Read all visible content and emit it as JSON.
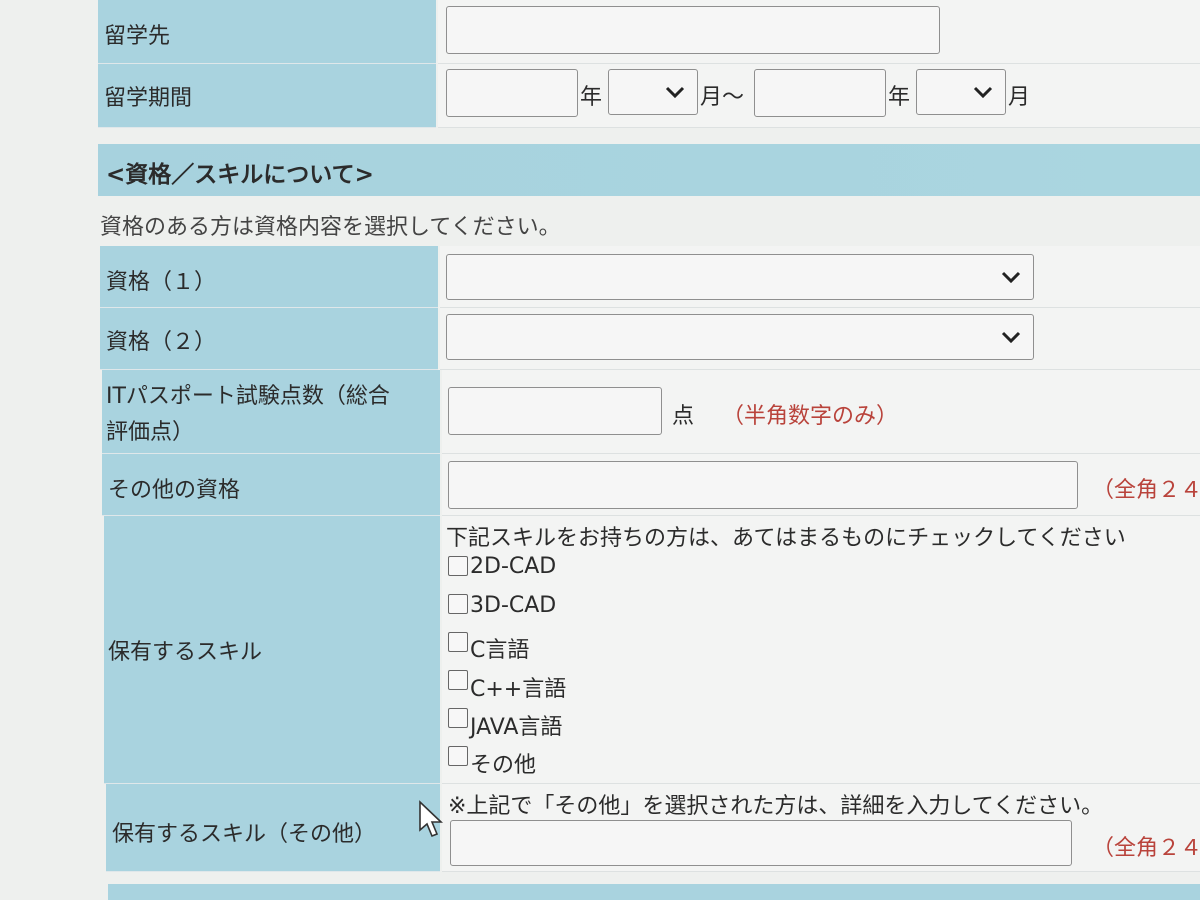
{
  "study_abroad": {
    "destination_label": "留学先",
    "destination_value": "",
    "period_label": "留学期間",
    "start_year_value": "",
    "year_unit": "年",
    "start_month_value": "",
    "month_range_sep": "月～",
    "end_year_value": "",
    "end_month_value": "",
    "month_unit": "月"
  },
  "section": {
    "title": "<資格／スキルについて>",
    "instruction": "資格のある方は資格内容を選択してください。"
  },
  "qualifications": [
    {
      "label": "資格（１）",
      "selected": ""
    },
    {
      "label": "資格（２）",
      "selected": ""
    }
  ],
  "it_passport": {
    "label_line1": "ITパスポート試験点数（総合",
    "label_line2": "評価点）",
    "value": "",
    "unit": "点",
    "note": "（半角数字のみ）"
  },
  "other_qualification": {
    "label": "その他の資格",
    "value": "",
    "note": "（全角２４"
  },
  "skills": {
    "label": "保有するスキル",
    "instruction": "下記スキルをお持ちの方は、あてはまるものにチェックしてください",
    "options": [
      {
        "label": "2D-CAD",
        "checked": false
      },
      {
        "label": "3D-CAD",
        "checked": false
      },
      {
        "label": "C言語",
        "checked": false
      },
      {
        "label": "C++言語",
        "checked": false
      },
      {
        "label": "JAVA言語",
        "checked": false
      },
      {
        "label": "その他",
        "checked": false
      }
    ]
  },
  "skills_other": {
    "label": "保有するスキル（その他）",
    "instruction": "※上記で「その他」を選択された方は、詳細を入力してください。",
    "value": "",
    "note": "（全角２４"
  },
  "colors": {
    "label_bg": "#a9d3df",
    "field_bg": "#f3f4f3",
    "note_red": "#b9433b"
  }
}
